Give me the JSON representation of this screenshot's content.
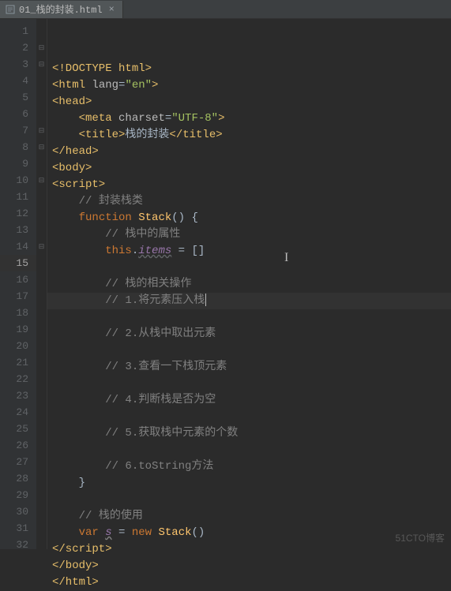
{
  "tab": {
    "filename": "01_栈的封装.html",
    "close_glyph": "×"
  },
  "fold": {
    "collapse": "⊟",
    "expand": "⊞"
  },
  "lines": [
    {
      "n": "1",
      "html": "<span class='tag'>&lt;!DOCTYPE html&gt;</span>"
    },
    {
      "n": "2",
      "html": "<span class='tag'>&lt;html </span><span class='attr-name'>lang</span><span class='op'>=</span><span class='attr-val'>\"en\"</span><span class='tag'>&gt;</span>",
      "fold": "collapse"
    },
    {
      "n": "3",
      "html": "<span class='tag'>&lt;head&gt;</span>",
      "fold": "collapse"
    },
    {
      "n": "4",
      "html": "    <span class='tag'>&lt;meta </span><span class='attr-name'>charset</span><span class='op'>=</span><span class='attr-val'>\"UTF-8\"</span><span class='tag'>&gt;</span>"
    },
    {
      "n": "5",
      "html": "    <span class='tag'>&lt;title&gt;</span><span class='title-text'>栈的封装</span><span class='tag'>&lt;/title&gt;</span>"
    },
    {
      "n": "6",
      "html": "<span class='tag'>&lt;/head&gt;</span>"
    },
    {
      "n": "7",
      "html": "<span class='tag'>&lt;body&gt;</span>",
      "fold": "collapse"
    },
    {
      "n": "8",
      "html": "<span class='tag'>&lt;script&gt;</span>",
      "fold": "collapse"
    },
    {
      "n": "9",
      "html": "    <span class='comment'>// 封装栈类</span>"
    },
    {
      "n": "10",
      "html": "    <span class='kw'>function</span> <span class='fn'>Stack</span><span class='punct'>()</span> <span class='punct'>{</span>",
      "fold": "collapse"
    },
    {
      "n": "11",
      "html": "        <span class='comment'>// 栈中的属性</span>"
    },
    {
      "n": "12",
      "html": "        <span class='this'>this</span><span class='punct'>.</span><span class='ident'>items</span> <span class='op'>=</span> <span class='bracket'>[]</span>"
    },
    {
      "n": "13",
      "html": ""
    },
    {
      "n": "14",
      "html": "        <span class='comment'>// 栈的相关操作</span>",
      "fold": "collapse"
    },
    {
      "n": "15",
      "html": "        <span class='comment'>// 1.将元素压入栈</span><span class='caret'></span>",
      "current": true
    },
    {
      "n": "16",
      "html": ""
    },
    {
      "n": "17",
      "html": "        <span class='comment'>// 2.从栈中取出元素</span>"
    },
    {
      "n": "18",
      "html": ""
    },
    {
      "n": "19",
      "html": "        <span class='comment'>// 3.查看一下栈顶元素</span>"
    },
    {
      "n": "20",
      "html": ""
    },
    {
      "n": "21",
      "html": "        <span class='comment'>// 4.判断栈是否为空</span>"
    },
    {
      "n": "22",
      "html": ""
    },
    {
      "n": "23",
      "html": "        <span class='comment'>// 5.获取栈中元素的个数</span>"
    },
    {
      "n": "24",
      "html": ""
    },
    {
      "n": "25",
      "html": "        <span class='comment'>// 6.toString方法</span>"
    },
    {
      "n": "26",
      "html": "    <span class='punct'>}</span>"
    },
    {
      "n": "27",
      "html": ""
    },
    {
      "n": "28",
      "html": "    <span class='comment'>// 栈的使用</span>"
    },
    {
      "n": "29",
      "html": "    <span class='kw'>var</span> <span class='ident u'>s</span> <span class='op'>=</span> <span class='kw'>new</span> <span class='fn'>Stack</span><span class='punct'>()</span>"
    },
    {
      "n": "30",
      "html": "<span class='tag'>&lt;/script&gt;</span>"
    },
    {
      "n": "31",
      "html": "<span class='tag'>&lt;/body&gt;</span>"
    },
    {
      "n": "32",
      "html": "<span class='tag'>&lt;/html&gt;</span>"
    }
  ],
  "watermark": "51CTO博客",
  "cursor_pos": {
    "line": 15
  }
}
